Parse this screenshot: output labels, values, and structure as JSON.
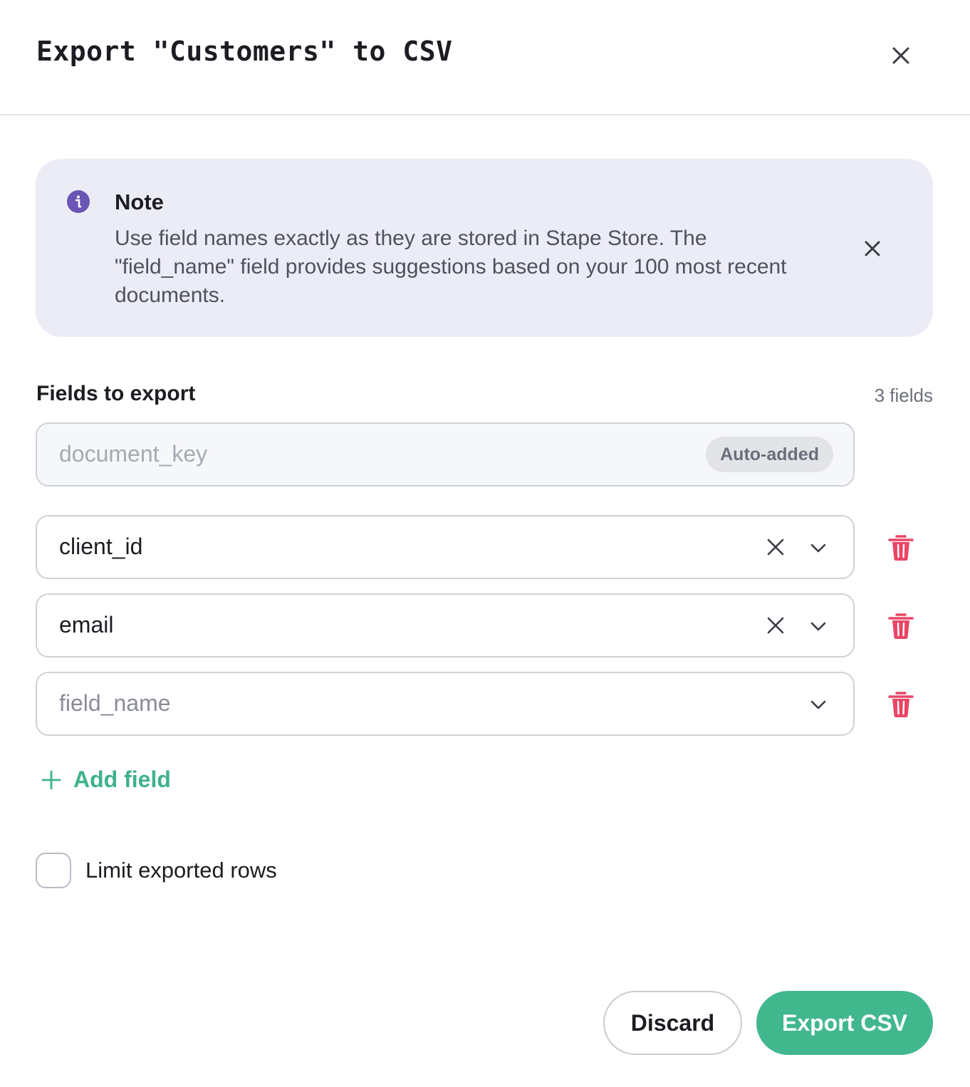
{
  "dialog": {
    "title": "Export \"Customers\" to CSV"
  },
  "note": {
    "title": "Note",
    "text": "Use field names exactly as they are stored in Stape Store. The \"field_name\" field provides suggestions based on your 100 most recent documents."
  },
  "fields_section": {
    "label": "Fields to export",
    "count": "3 fields",
    "auto_field": {
      "value": "document_key",
      "badge": "Auto-added"
    },
    "fields": [
      {
        "value": "client_id"
      },
      {
        "value": "email"
      },
      {
        "placeholder": "field_name"
      }
    ],
    "add_label": "Add field"
  },
  "options": {
    "limit_rows_label": "Limit exported rows",
    "limit_rows_checked": false
  },
  "footer": {
    "discard_label": "Discard",
    "export_label": "Export CSV"
  },
  "colors": {
    "accent": "#41b78d",
    "danger": "#ea4566",
    "info": "#6a55b5",
    "note_bg": "#ececf6"
  },
  "icons": [
    "close-icon",
    "info-icon",
    "clear-icon",
    "chevron-down-icon",
    "trash-icon",
    "plus-icon"
  ]
}
